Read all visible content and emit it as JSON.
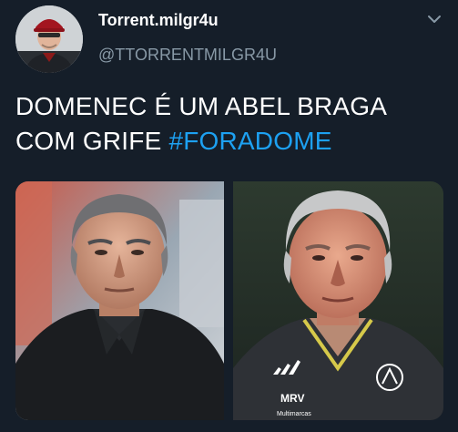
{
  "tweet": {
    "author": {
      "display_name": "Torrent.milgr4u",
      "handle": "@TTORRENTMILGR4U",
      "avatar_icon": "user-avatar-photo"
    },
    "menu_icon": "chevron-down-icon",
    "text": {
      "line1": "DOMENEC É UM ABEL BRAGA",
      "line2_prefix": "COM GRIFE ",
      "hashtag": "#FORADOME"
    },
    "media": [
      {
        "description_icon": "photo-man-black-polo"
      },
      {
        "description_icon": "photo-man-flamengo-jersey",
        "jersey_text": "MRV",
        "sponsor_text": "Multimarcas"
      }
    ]
  },
  "colors": {
    "background": "#151e29",
    "text": "#ffffff",
    "secondary": "#8899a6",
    "link": "#1da1f2"
  }
}
